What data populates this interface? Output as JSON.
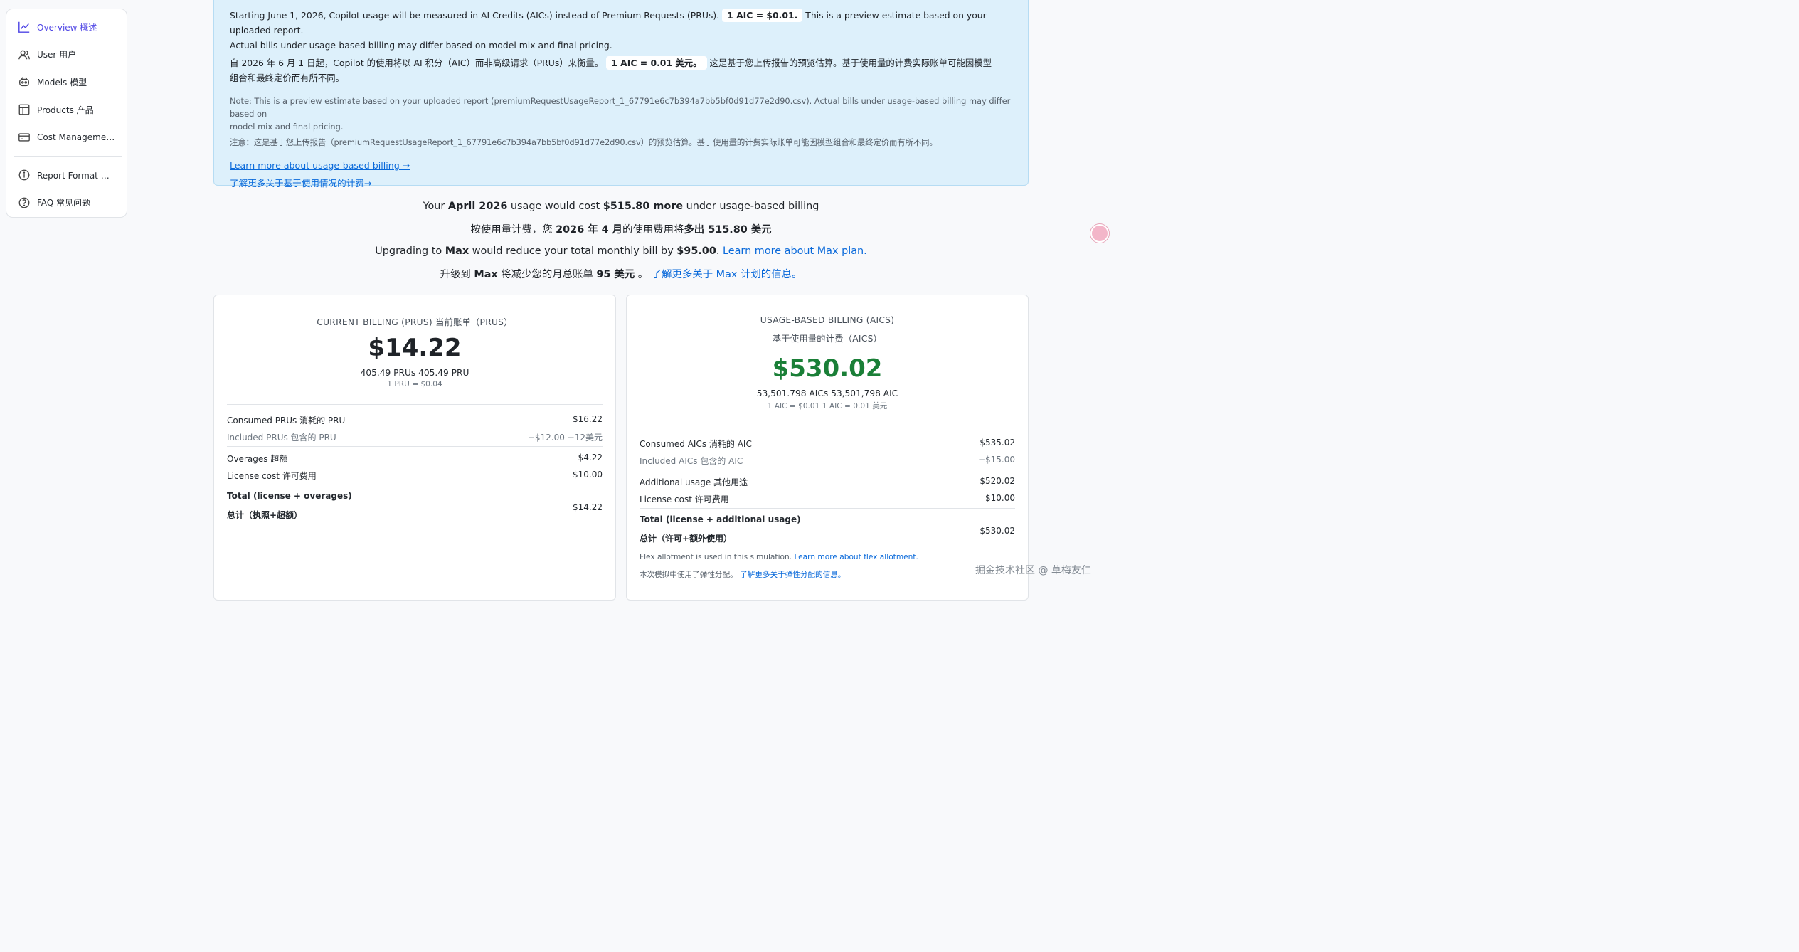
{
  "sidebar": {
    "items": [
      {
        "icon": "chart-line-icon",
        "label": "Overview  概述",
        "active": true
      },
      {
        "icon": "users-icon",
        "label": "User  用户"
      },
      {
        "icon": "models-icon",
        "label": "Models  模型"
      },
      {
        "icon": "table-icon",
        "label": "Products  产品"
      },
      {
        "icon": "credit-card-icon",
        "label": "Cost Managemen..."
      },
      {
        "icon": "info-icon",
        "label": "Report Format  报..."
      },
      {
        "icon": "question-icon",
        "label": "FAQ  常见问题"
      }
    ]
  },
  "banner": {
    "en_line1_pre": "Starting June 1, 2026, Copilot usage will be measured in AI Credits (AICs) instead of Premium Requests (PRUs).",
    "en_pill": "1 AIC = $0.01.",
    "en_line1_post": "This is a preview estimate based on your uploaded report.",
    "en_line2": "Actual bills under usage-based billing may differ based on model mix and final pricing.",
    "zh_line1_pre": "自 2026 年 6 月 1 日起，Copilot 的使用将以 AI 积分（AIC）而非高级请求（PRUs）来衡量。",
    "zh_pill": "1 AIC = 0.01 美元。",
    "zh_line1_post": "这是基于您上传报告的预览估算。基于使用量的计费实际账单可能因模型",
    "zh_line2": "组合和最终定价而有所不同。",
    "note_en1": "Note: This is a preview estimate based on your uploaded report (premiumRequestUsageReport_1_67791e6c7b394a7bb5bf0d91d77e2d90.csv). Actual bills under usage-based billing may differ based on",
    "note_en2": "model mix and final pricing.",
    "note_zh": "注意：这是基于您上传报告（premiumRequestUsageReport_1_67791e6c7b394a7bb5bf0d91d77e2d90.csv）的预览估算。基于使用量的计费实际账单可能因模型组合和最终定价而有所不同。",
    "link_en": "Learn more about usage-based billing →",
    "link_zh": "了解更多关于基于使用情况的计费→"
  },
  "summary": {
    "l1_a": "Your ",
    "l1_b": "April 2026",
    "l1_c": " usage would cost ",
    "l1_d": "$515.80 more",
    "l1_e": " under usage-based billing",
    "l2_a": "按使用量计费，您 ",
    "l2_b": "2026 年 4 月",
    "l2_c": "的使用费用将",
    "l2_d": "多出 515.80 美元",
    "l3_a": "Upgrading to ",
    "l3_b": "Max",
    "l3_c": " would reduce your total monthly bill by ",
    "l3_d": "$95.00",
    "l3_e": ". ",
    "l3_link": "Learn more about Max plan.",
    "l4_a": "升级到 ",
    "l4_b": "Max",
    "l4_c": " 将减少您的月总账单 ",
    "l4_d": "95 美元",
    "l4_e": " 。 ",
    "l4_link": "了解更多关于 Max 计划的信息。"
  },
  "current": {
    "title": "CURRENT BILLING (PRUS)  当前账单（PRUS）",
    "amount": "$14.22",
    "sub": "405.49 PRUs  405.49 PRU",
    "rate": "1 PRU = $0.04",
    "rows": [
      {
        "label": "Consumed PRUs  消耗的 PRU",
        "value": "$16.22"
      },
      {
        "label": "Included PRUs  包含的 PRU",
        "value": "−$12.00  −12美元"
      },
      {
        "label": "Overages  超额",
        "value": "$4.22"
      },
      {
        "label": "License cost  许可费用",
        "value": "$10.00"
      }
    ],
    "total_en": "Total (license + overages)",
    "total_zh": "总计（执照+超额）",
    "total_value": "$14.22"
  },
  "usage": {
    "title": "USAGE-BASED BILLING (AICS)",
    "title_zh": "基于使用量的计费（AICS）",
    "amount": "$530.02",
    "amount_color": "#1a7f37",
    "sub": "53,501.798 AICs  53,501,798 AIC",
    "rate": "1 AIC = $0.01  1 AIC = 0.01 美元",
    "rows": [
      {
        "label": "Consumed AICs  消耗的 AIC",
        "value": "$535.02"
      },
      {
        "label": "Included AICs  包含的 AIC",
        "value": "−$15.00"
      },
      {
        "label": "Additional usage  其他用途",
        "value": "$520.02"
      },
      {
        "label": "License cost  许可费用",
        "value": "$10.00"
      }
    ],
    "total_en": "Total (license + additional usage)",
    "total_zh": "总计（许可+额外使用）",
    "total_value": "$530.02",
    "flex_en": "Flex allotment is used in this simulation. ",
    "flex_en_link": "Learn more about flex allotment.",
    "flex_zh": "本次模拟中使用了弹性分配。 ",
    "flex_zh_link": "了解更多关于弹性分配的信息。"
  },
  "watermark": "掘金技术社区 @ 草梅友仁"
}
